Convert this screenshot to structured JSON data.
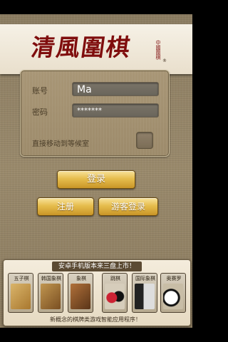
{
  "app": {
    "title": "清風圍棋",
    "seal_text": "中國圍棋",
    "reg_mark": "®"
  },
  "login": {
    "account_label": "账号",
    "account_value": "Ma",
    "password_label": "密码",
    "password_value": "*******",
    "auto_room_label": "直接移动到等候室"
  },
  "buttons": {
    "login": "登录",
    "register": "注册",
    "guest_login": "游客登录"
  },
  "promo": {
    "top_text": "安卓手机版本来三盘上市！",
    "bottom_text": "新概念的棋牌类游戏智能应用程序！",
    "apps": [
      {
        "label": "五子棋",
        "icon": "gomoku-board-icon",
        "color": "#b98a3e"
      },
      {
        "label": "韩国象棋",
        "icon": "janggi-board-icon",
        "color": "#8a5a2a"
      },
      {
        "label": "象棋",
        "icon": "xiangqi-board-icon",
        "color": "#6a3f1e"
      },
      {
        "label": "跳棋",
        "icon": "checkers-pieces-icon",
        "color": "#3a2a2a"
      },
      {
        "label": "国际象棋",
        "icon": "chess-pieces-icon",
        "color": "#5a5046"
      },
      {
        "label": "奥赛罗",
        "icon": "othello-pieces-icon",
        "color": "#4a4036"
      }
    ]
  },
  "colors": {
    "banner_text": "#7f0d0d",
    "gold_button": "#e6bd4d",
    "background": "#9a8a6c"
  }
}
